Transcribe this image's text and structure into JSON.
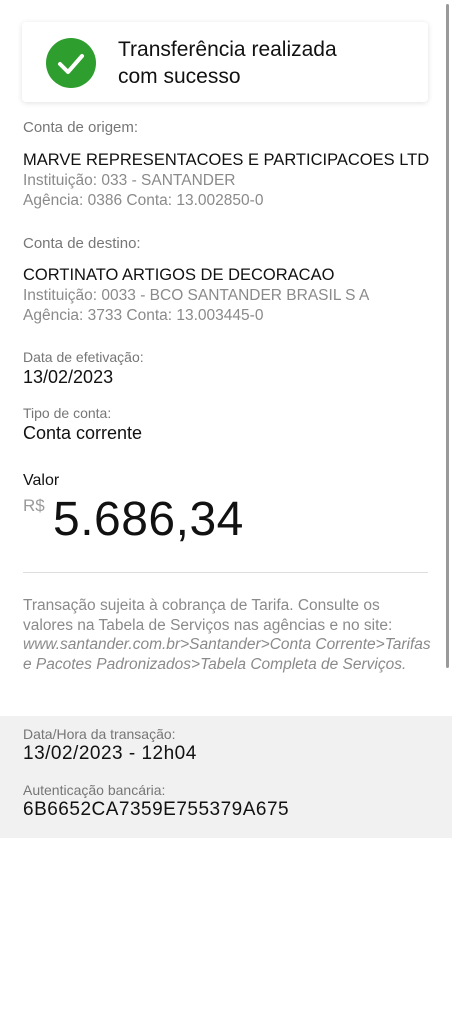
{
  "status": {
    "title_line1": "Transferência realizada",
    "title_line2": "com sucesso",
    "color": "#2e9e2e",
    "icon": "checkmark-icon"
  },
  "origin": {
    "label": "Conta de origem:",
    "name": "MARVE REPRESENTACOES E PARTICIPACOES LTD",
    "institution": "Instituição: 033 - SANTANDER",
    "branch_account": "Agência: 0386 Conta: 13.002850-0"
  },
  "destination": {
    "label": "Conta de destino:",
    "name": "CORTINATO ARTIGOS DE DECORACAO",
    "institution": "Instituição: 0033 - BCO SANTANDER  BRASIL  S A",
    "branch_account": "Agência: 3733 Conta: 13.003445-0"
  },
  "effective_date": {
    "label": "Data de efetivação:",
    "value": "13/02/2023"
  },
  "account_type": {
    "label": "Tipo de conta:",
    "value": "Conta corrente"
  },
  "amount": {
    "label": "Valor",
    "currency": "R$",
    "value": "5.686,34"
  },
  "disclaimer": {
    "text": "Transação sujeita à cobrança de Tarifa. Consulte os valores na Tabela de Serviços nas agências e no site:",
    "link_text": "www.santander.com.br>Santander>Conta Corrente>Tarifas e Pacotes Padronizados>Tabela Completa de Serviços."
  },
  "footer": {
    "datetime_label": "Data/Hora da transação:",
    "datetime_value": "13/02/2023 - 12h04",
    "auth_label": "Autenticação bancária:",
    "auth_value": "6B6652CA7359E755379A675"
  }
}
